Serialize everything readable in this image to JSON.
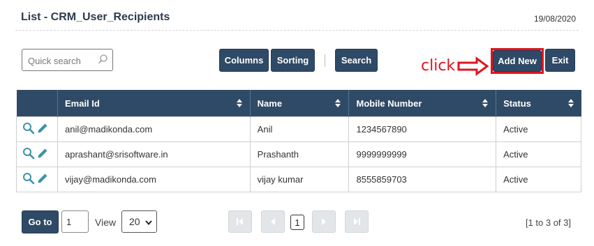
{
  "header": {
    "title": "List - CRM_User_Recipients",
    "date": "19/08/2020"
  },
  "toolbar": {
    "search_placeholder": "Quick search",
    "columns_label": "Columns",
    "sorting_label": "Sorting",
    "search_label": "Search",
    "add_new_label": "Add New",
    "exit_label": "Exit"
  },
  "annotation": {
    "text": "click",
    "color": "#e0141e"
  },
  "table": {
    "columns": [
      "Email Id",
      "Name",
      "Mobile Number",
      "Status"
    ],
    "rows": [
      {
        "email": "anil@madikonda.com",
        "name": "Anil",
        "mobile": "1234567890",
        "status": "Active"
      },
      {
        "email": "aprashant@srisoftware.in",
        "name": "Prashanth",
        "mobile": "9999999999",
        "status": "Active"
      },
      {
        "email": "vijay@madikonda.com",
        "name": "vijay kumar",
        "mobile": "8555859703",
        "status": "Active"
      }
    ]
  },
  "pagination": {
    "goto_label": "Go to",
    "page_value": "1",
    "view_label": "View",
    "page_size": "20",
    "current_page": "1",
    "range_text": "[1 to 3 of 3]"
  },
  "colors": {
    "header_bg": "#2f4a66",
    "icon_teal": "#3a93a8",
    "highlight": "#e0141e"
  }
}
